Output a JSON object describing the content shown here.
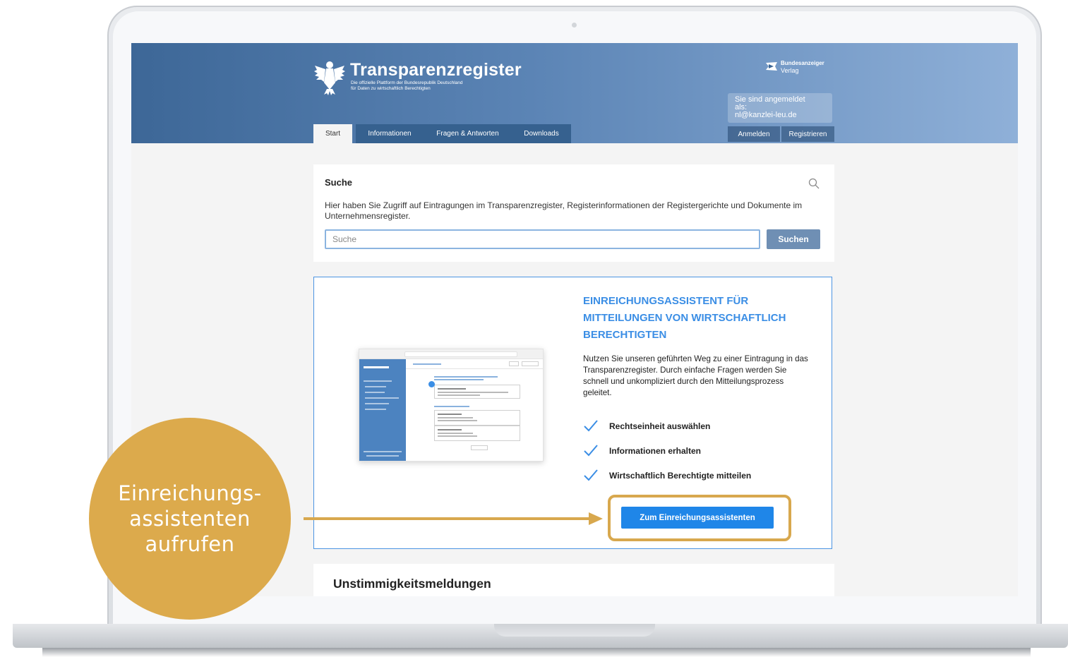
{
  "header": {
    "brand_title": "Transparenzregister",
    "brand_subtitle_line1": "Die offizielle Plattform der Bundesrepublik Deutschland",
    "brand_subtitle_line2": "für Daten zu wirtschaftlich Berechtigten",
    "publisher_name": "Bundesanzeiger",
    "publisher_sub": "Verlag",
    "login_status_line1": "Sie sind angemeldet",
    "login_status_line2": "als:",
    "login_status_line3": "nl@kanzlei-leu.de",
    "login_button": "Anmelden",
    "register_button": "Registrieren"
  },
  "nav": {
    "tabs": [
      {
        "label": "Start",
        "active": true
      },
      {
        "label": "Informationen",
        "active": false
      },
      {
        "label": "Fragen & Antworten",
        "active": false
      },
      {
        "label": "Downloads",
        "active": false
      }
    ]
  },
  "search": {
    "title": "Suche",
    "description": "Hier haben Sie Zugriff auf Eintragungen im Transparenzregister, Registerinformationen der Registergerichte und Dokumente im Unternehmensregister.",
    "placeholder": "Suche",
    "button": "Suchen"
  },
  "assistant": {
    "heading": "EINREICHUNGSASSISTENT FÜR MITTEILUNGEN VON WIRTSCHAFTLICH BERECHTIGTEN",
    "text": "Nutzen Sie unseren geführten Weg zu einer Eintragung in das Transparenzregister. Durch einfache Fragen werden Sie schnell und unkompliziert durch den Mitteilungsprozess geleitet.",
    "checklist": [
      "Rechtseinheit auswählen",
      "Informationen erhalten",
      "Wirtschaftlich Berechtigte mitteilen"
    ],
    "button": "Zum Einreichungsassistenten"
  },
  "bottom_section": {
    "title": "Unstimmigkeitsmeldungen"
  },
  "annotation": {
    "line1": "Einreichungs-",
    "line2": "assistenten",
    "line3": "aufrufen"
  },
  "colors": {
    "header_start": "#3d6797",
    "header_end": "#8fb0d8",
    "accent_blue": "#1f86e8",
    "heading_blue": "#3b8ee5",
    "annotation_gold": "#d8a84e"
  }
}
